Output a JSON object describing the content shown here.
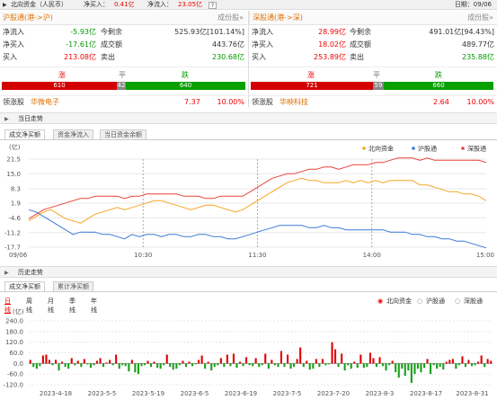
{
  "topbar": {
    "title": "北向资金（人民币）",
    "net_buy_label": "净买入：",
    "net_buy_value": "0.41亿",
    "net_inflow_label": "净流入：",
    "net_inflow_value": "23.05亿",
    "help": "?",
    "date_label": "日期：09/06"
  },
  "left": {
    "name": "沪股通(港->沪)",
    "constituents": "成份股»",
    "rows": [
      {
        "l1": "净流入",
        "v1": "-5.93亿",
        "l2": "今剩余",
        "v2": "525.93亿[101.14%]"
      },
      {
        "l1": "净买入",
        "v1": "-17.61亿",
        "l2": "成交额",
        "v2": "443.76亿"
      },
      {
        "l1": "买入",
        "v1": "213.08亿",
        "l2": "卖出",
        "v2": "230.68亿"
      }
    ],
    "up_label": "涨",
    "flat_label": "平",
    "down_label": "跌",
    "up": "610",
    "flat": "42",
    "down": "640",
    "leader_label": "领涨股",
    "leader": "华微电子",
    "leader_price": "7.37",
    "leader_pct": "10.00%"
  },
  "right": {
    "name": "深股通(港->深)",
    "constituents": "成份股»",
    "rows": [
      {
        "l1": "净流入",
        "v1": "28.99亿",
        "l2": "今剩余",
        "v2": "491.01亿[94.43%]"
      },
      {
        "l1": "净买入",
        "v1": "18.02亿",
        "l2": "成交额",
        "v2": "489.77亿"
      },
      {
        "l1": "买入",
        "v1": "253.89亿",
        "l2": "卖出",
        "v2": "235.88亿"
      }
    ],
    "up_label": "涨",
    "flat_label": "平",
    "down_label": "跌",
    "up": "721",
    "flat": "59",
    "down": "660",
    "leader_label": "领涨股",
    "leader": "华映科技",
    "leader_price": "2.64",
    "leader_pct": "10.00%"
  },
  "today": {
    "section_title": "当日走势",
    "tabs": [
      "成交净买额",
      "资金净流入",
      "当日资金余额"
    ]
  },
  "history": {
    "section_title": "历史走势",
    "tabs": [
      "成交净买额",
      "累计净买额"
    ],
    "periods": [
      "日线",
      "周线",
      "月线",
      "季线",
      "年线"
    ],
    "radios": [
      "北向资金",
      "沪股通",
      "深股通"
    ]
  },
  "chart_data": [
    {
      "type": "line",
      "ylabel": "(亿)",
      "yticks": [
        21.5,
        15.0,
        8.3,
        1.9,
        -4.6,
        -11.2,
        -17.7
      ],
      "ylim": [
        -17.7,
        21.5
      ],
      "xticks": [
        "09/06",
        "10:30",
        "11:30",
        "14:00",
        "15:00"
      ],
      "grid": true,
      "legend": "top-right",
      "series": [
        {
          "name": "北向资金",
          "color": "#f5a623",
          "values": [
            -6,
            -4,
            -2,
            -1,
            -3,
            -5,
            -6,
            -7,
            -5,
            -3,
            -2,
            -1,
            0,
            -1,
            0,
            1,
            2,
            3,
            3,
            2,
            1,
            0,
            -1,
            0,
            1,
            1,
            0,
            -1,
            -2,
            -1,
            1,
            3,
            5,
            7,
            9,
            11,
            12,
            13,
            12,
            12,
            11,
            11,
            11,
            12,
            11,
            12,
            11,
            12,
            11,
            12,
            12,
            12,
            12,
            10,
            10,
            9,
            8,
            7,
            7,
            6,
            6,
            5,
            3
          ]
        },
        {
          "name": "沪股通",
          "color": "#3a7bd5",
          "values": [
            -1,
            -2,
            -4,
            -6,
            -8,
            -10,
            -12,
            -11,
            -11,
            -11,
            -12,
            -12,
            -13,
            -14,
            -12,
            -13,
            -12,
            -12,
            -13,
            -12,
            -12,
            -13,
            -13,
            -12,
            -12,
            -13,
            -13,
            -14,
            -14,
            -13,
            -12,
            -11,
            -10,
            -9,
            -8,
            -8,
            -8,
            -8,
            -9,
            -9,
            -8,
            -9,
            -9,
            -10,
            -10,
            -10,
            -10,
            -10,
            -10,
            -11,
            -11,
            -11,
            -12,
            -12,
            -13,
            -13,
            -14,
            -14,
            -15,
            -15,
            -16,
            -17,
            -18
          ]
        },
        {
          "name": "深股通",
          "color": "#e8433a",
          "values": [
            -5,
            -3,
            -1,
            0,
            1,
            2,
            3,
            4,
            4,
            5,
            5,
            5,
            5,
            4,
            5,
            5,
            6,
            6,
            6,
            6,
            6,
            5,
            5,
            5,
            4,
            4,
            5,
            5,
            5,
            5,
            7,
            9,
            11,
            13,
            14,
            15,
            15,
            16,
            17,
            17,
            18,
            18,
            17,
            18,
            19,
            19,
            19,
            20,
            20,
            21,
            22,
            22,
            22,
            21,
            22,
            21,
            21,
            21,
            21,
            21,
            21,
            21,
            20
          ]
        }
      ]
    },
    {
      "type": "bar",
      "ylabel": "(亿)",
      "yticks": [
        240.0,
        180.0,
        120.0,
        60.0,
        0.0,
        -60.0,
        -120.0
      ],
      "ylim": [
        -120,
        240
      ],
      "xticks": [
        "2023-4-18",
        "2023-5-5",
        "2023-5-19",
        "2023-6-5",
        "2023-6-19",
        "2023-7-5",
        "2023-7-20",
        "2023-8-3",
        "2023-8-17",
        "2023-8-31"
      ],
      "grid": true,
      "values": [
        20,
        -20,
        -30,
        -15,
        45,
        50,
        20,
        -10,
        20,
        -40,
        10,
        -20,
        -30,
        30,
        -10,
        15,
        -20,
        25,
        -5,
        -25,
        -10,
        15,
        30,
        -20,
        5,
        20,
        -10,
        50,
        -30,
        -10,
        -15,
        -45,
        20,
        -50,
        -60,
        -15,
        -10,
        15,
        -20,
        10,
        -25,
        -30,
        -10,
        50,
        -20,
        -35,
        -30,
        -10,
        15,
        -20,
        10,
        -15,
        -5,
        20,
        45,
        -30,
        10,
        -40,
        -20,
        -10,
        30,
        -20,
        50,
        -15,
        55,
        -25,
        10,
        -15,
        35,
        -10,
        -15,
        30,
        -20,
        -10,
        55,
        -30,
        20,
        -10,
        -20,
        70,
        -20,
        50,
        -30,
        -20,
        25,
        90,
        -20,
        15,
        -35,
        -30,
        25,
        -20,
        25,
        -10,
        -5,
        120,
        80,
        -20,
        55,
        -40,
        -10,
        -30,
        10,
        -25,
        50,
        -25,
        -20,
        60,
        30,
        -20,
        35,
        -15,
        -40,
        -10,
        15,
        -50,
        -80,
        -30,
        -70,
        -40,
        -110,
        -60,
        -30,
        -50,
        -25,
        25,
        -60,
        -10,
        -30,
        -20,
        -35,
        10,
        20,
        25,
        -30,
        -10,
        40,
        -20,
        20,
        -15,
        -10,
        10,
        45,
        -20,
        25,
        15
      ]
    }
  ]
}
